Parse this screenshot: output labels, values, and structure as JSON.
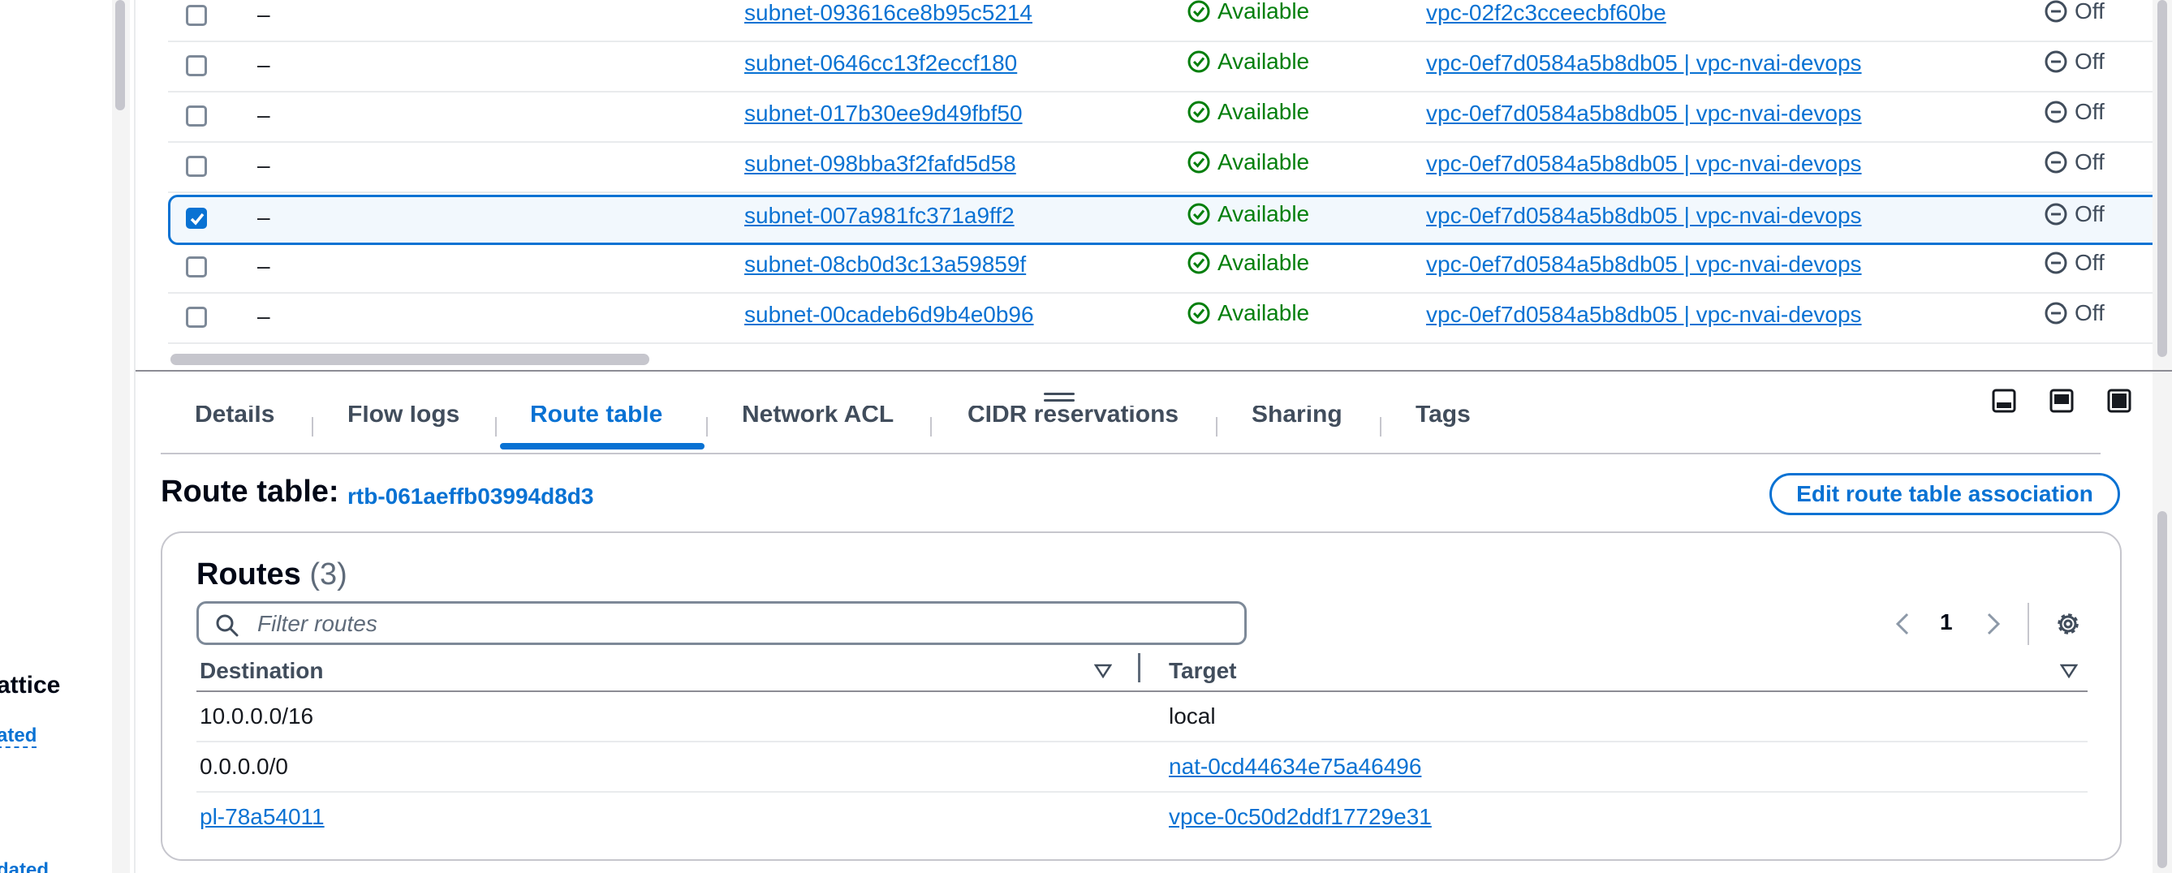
{
  "left_nav": {
    "cut_heading": "attice",
    "cut_link_1": "ated",
    "cut_link_2": "dated"
  },
  "subnets": [
    {
      "name": "–",
      "subnet_id": "subnet-093616ce8b95c5214",
      "state": "Available",
      "vpc": "vpc-02f2c3cceecbf60be",
      "auto_assign": "Off",
      "selected": false
    },
    {
      "name": "–",
      "subnet_id": "subnet-0646cc13f2eccf180",
      "state": "Available",
      "vpc": "vpc-0ef7d0584a5b8db05 | vpc-nvai-devops",
      "auto_assign": "Off",
      "selected": false
    },
    {
      "name": "–",
      "subnet_id": "subnet-017b30ee9d49fbf50",
      "state": "Available",
      "vpc": "vpc-0ef7d0584a5b8db05 | vpc-nvai-devops",
      "auto_assign": "Off",
      "selected": false
    },
    {
      "name": "–",
      "subnet_id": "subnet-098bba3f2fafd5d58",
      "state": "Available",
      "vpc": "vpc-0ef7d0584a5b8db05 | vpc-nvai-devops",
      "auto_assign": "Off",
      "selected": false
    },
    {
      "name": "–",
      "subnet_id": "subnet-007a981fc371a9ff2",
      "state": "Available",
      "vpc": "vpc-0ef7d0584a5b8db05 | vpc-nvai-devops",
      "auto_assign": "Off",
      "selected": true
    },
    {
      "name": "–",
      "subnet_id": "subnet-08cb0d3c13a59859f",
      "state": "Available",
      "vpc": "vpc-0ef7d0584a5b8db05 | vpc-nvai-devops",
      "auto_assign": "Off",
      "selected": false
    },
    {
      "name": "–",
      "subnet_id": "subnet-00cadeb6d9b4e0b96",
      "state": "Available",
      "vpc": "vpc-0ef7d0584a5b8db05 | vpc-nvai-devops",
      "auto_assign": "Off",
      "selected": false
    }
  ],
  "tabs": [
    "Details",
    "Flow logs",
    "Route table",
    "Network ACL",
    "CIDR reservations",
    "Sharing",
    "Tags"
  ],
  "active_tab": "Route table",
  "route_table": {
    "title": "Route table:",
    "id": "rtb-061aeffb03994d8d3",
    "edit_button": "Edit route table association"
  },
  "routes": {
    "title": "Routes",
    "count": "(3)",
    "filter_placeholder": "Filter routes",
    "page": "1",
    "col_destination": "Destination",
    "col_target": "Target",
    "rows": [
      {
        "destination": "10.0.0.0/16",
        "target": "local",
        "dest_link": false,
        "target_link": false
      },
      {
        "destination": "0.0.0.0/0",
        "target": "nat-0cd44634e75a46496",
        "dest_link": false,
        "target_link": true
      },
      {
        "destination": "pl-78a54011",
        "target": "vpce-0c50d2ddf17729e31",
        "dest_link": true,
        "target_link": true
      }
    ]
  },
  "icons": {
    "status_ok": "check-circle-icon",
    "status_off": "minus-circle-icon",
    "search": "search-icon",
    "settings": "gear-icon",
    "sort": "caret-down-icon"
  },
  "colors": {
    "link": "#0972d3",
    "success": "#037f0c",
    "selected_border": "#0972d3"
  }
}
